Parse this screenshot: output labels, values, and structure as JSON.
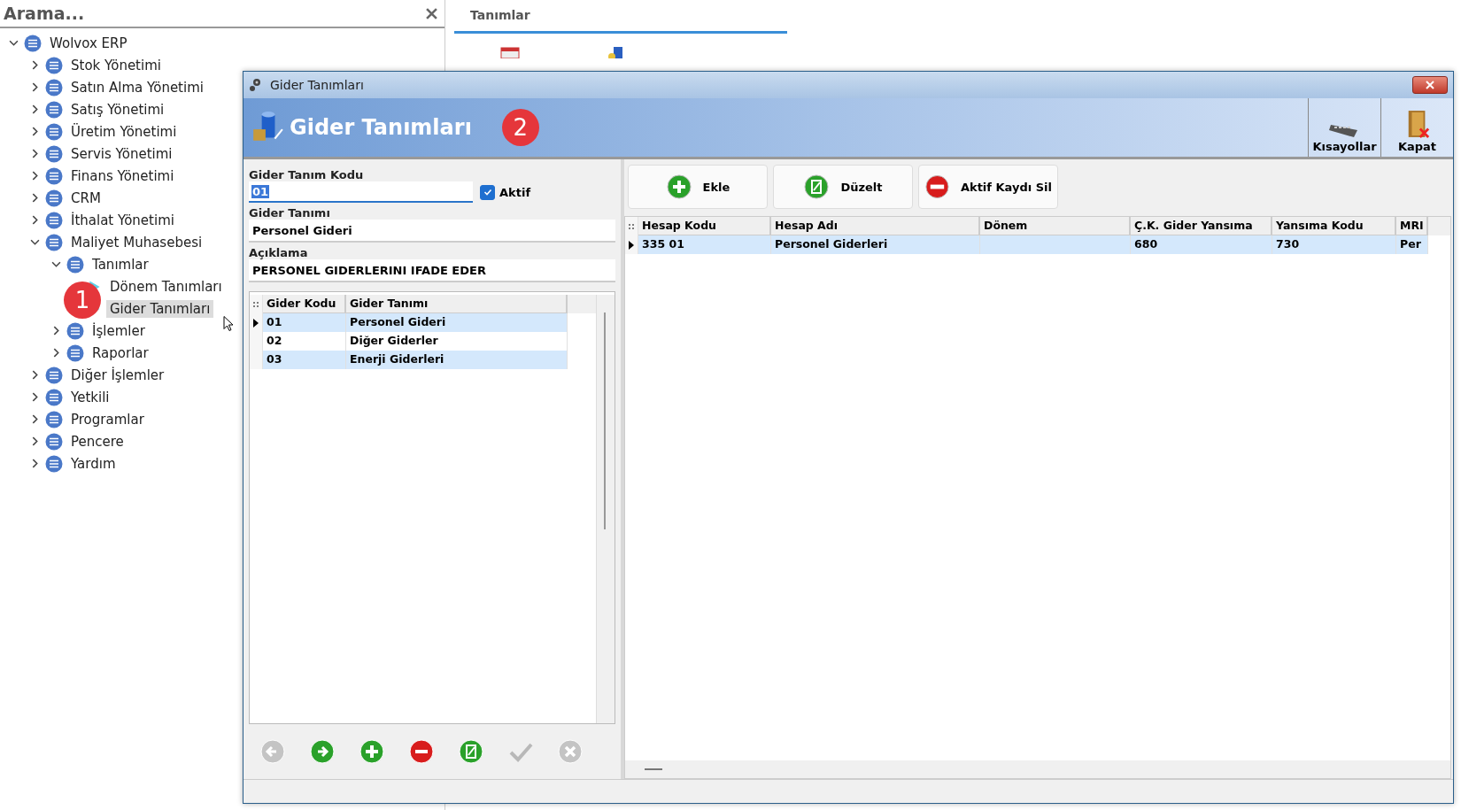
{
  "search": {
    "placeholder": "Arama..."
  },
  "tree": [
    {
      "label": "Wolvox ERP",
      "kind": "group",
      "expanded": true,
      "selected": false,
      "children": [
        {
          "label": "Stok Yönetimi",
          "kind": "group",
          "expanded": false,
          "selected": false
        },
        {
          "label": "Satın Alma Yönetimi",
          "kind": "group",
          "expanded": false,
          "selected": false
        },
        {
          "label": "Satış Yönetimi",
          "kind": "group",
          "expanded": false,
          "selected": false
        },
        {
          "label": "Üretim Yönetimi",
          "kind": "group",
          "expanded": false,
          "selected": false
        },
        {
          "label": "Servis Yönetimi",
          "kind": "group",
          "expanded": false,
          "selected": false
        },
        {
          "label": "Finans Yönetimi",
          "kind": "group",
          "expanded": false,
          "selected": false
        },
        {
          "label": "CRM",
          "kind": "group",
          "expanded": false,
          "selected": false
        },
        {
          "label": "İthalat Yönetimi",
          "kind": "group",
          "expanded": false,
          "selected": false
        },
        {
          "label": "Maliyet Muhasebesi",
          "kind": "group",
          "expanded": true,
          "selected": false,
          "children": [
            {
              "label": "Tanımlar",
              "kind": "group",
              "expanded": true,
              "selected": false,
              "children": [
                {
                  "label": "Dönem Tanımları",
                  "kind": "page",
                  "selected": false
                },
                {
                  "label": "Gider Tanımları",
                  "kind": "page",
                  "selected": true
                }
              ]
            },
            {
              "label": "İşlemler",
              "kind": "group",
              "expanded": false,
              "selected": false
            },
            {
              "label": "Raporlar",
              "kind": "group",
              "expanded": false,
              "selected": false
            }
          ]
        },
        {
          "label": "Diğer İşlemler",
          "kind": "group",
          "expanded": false,
          "selected": false
        },
        {
          "label": "Yetkili",
          "kind": "group",
          "expanded": false,
          "selected": false
        },
        {
          "label": "Programlar",
          "kind": "group",
          "expanded": false,
          "selected": false
        },
        {
          "label": "Pencere",
          "kind": "group",
          "expanded": false,
          "selected": false
        },
        {
          "label": "Yardım",
          "kind": "group",
          "expanded": false,
          "selected": false
        }
      ]
    }
  ],
  "annotations": [
    "1",
    "2"
  ],
  "background_tab": {
    "label": "Tanımlar"
  },
  "dialog": {
    "title": "Gider Tanımları",
    "header": "Gider Tanımları",
    "header_buttons": [
      {
        "label": "Kısayollar",
        "kind": "keyboard"
      },
      {
        "label": "Kapat",
        "kind": "exit"
      }
    ],
    "form": {
      "code_label": "Gider Tanım Kodu",
      "code_value": "01",
      "active_label": "Aktif",
      "active_checked": true,
      "name_label": "Gider Tanımı",
      "name_value": "Personel Gideri",
      "desc_label": "Açıklama",
      "desc_value": "PERSONEL GIDERLERINI IFADE EDER"
    },
    "list": {
      "columns": [
        "Gider Kodu",
        "Gider Tanımı"
      ],
      "rows": [
        {
          "cells": [
            "01",
            "Personel Gideri"
          ],
          "current": true,
          "shaded": true
        },
        {
          "cells": [
            "02",
            "Diğer Giderler"
          ],
          "current": false,
          "shaded": false
        },
        {
          "cells": [
            "03",
            "Enerji Giderleri"
          ],
          "current": false,
          "shaded": true
        }
      ]
    },
    "nav_buttons": [
      {
        "kind": "prev",
        "disabled": true
      },
      {
        "kind": "next",
        "disabled": false
      },
      {
        "kind": "add",
        "disabled": false
      },
      {
        "kind": "delete",
        "disabled": false
      },
      {
        "kind": "edit",
        "disabled": false
      },
      {
        "kind": "post",
        "disabled": true
      },
      {
        "kind": "cancel",
        "disabled": true
      }
    ],
    "actions": [
      {
        "label": "Ekle",
        "kind": "add"
      },
      {
        "label": "Düzelt",
        "kind": "edit"
      },
      {
        "label": "Aktif Kaydı Sil",
        "kind": "delete"
      }
    ],
    "grid": {
      "columns": [
        "Hesap Kodu",
        "Hesap Adı",
        "Dönem",
        "Ç.K. Gider Yansıma",
        "Yansıma Kodu",
        "MRI"
      ],
      "rows": [
        {
          "cells": [
            "335 01",
            "Personel Giderleri",
            "",
            "680",
            "730",
            "Per"
          ],
          "current": true,
          "shaded": true
        }
      ]
    }
  }
}
